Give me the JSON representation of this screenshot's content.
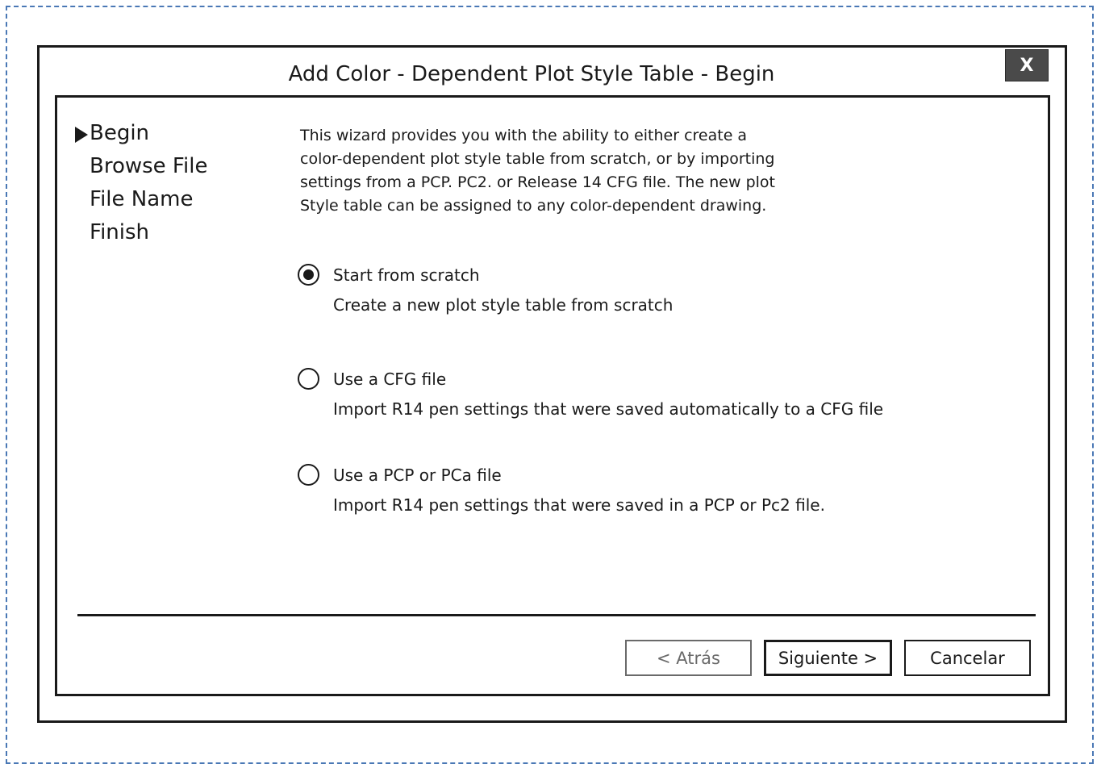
{
  "window": {
    "title": "Add Color - Dependent Plot Style Table - Begin",
    "close_label": "X"
  },
  "steps": [
    {
      "label": "Begin",
      "current": true
    },
    {
      "label": "Browse File",
      "current": false
    },
    {
      "label": "File Name",
      "current": false
    },
    {
      "label": "Finish",
      "current": false
    }
  ],
  "intro": [
    "This wizard provides you with the ability to either create a",
    "color-dependent plot style table from scratch, or by importing",
    "settings from a PCP. PC2. or Release 14 CFG file. The new plot",
    "Style table can be assigned to any color-dependent drawing."
  ],
  "options": [
    {
      "label": "Start from scratch",
      "description": "Create a new plot style table from scratch",
      "selected": true
    },
    {
      "label": "Use a CFG file",
      "description": "Import R14 pen settings that were saved automatically to a CFG file",
      "selected": false
    },
    {
      "label": "Use a PCP or PCa file",
      "description": "Import R14 pen settings that were saved in a PCP or Pc2 file.",
      "selected": false
    }
  ],
  "buttons": {
    "back": "< Atrás",
    "next": "Siguiente >",
    "cancel": "Cancelar"
  },
  "colors": {
    "frame_border": "#4a78b5",
    "close_button_bg": "#4a4a4a",
    "disabled_text": "#6a6a6a"
  }
}
